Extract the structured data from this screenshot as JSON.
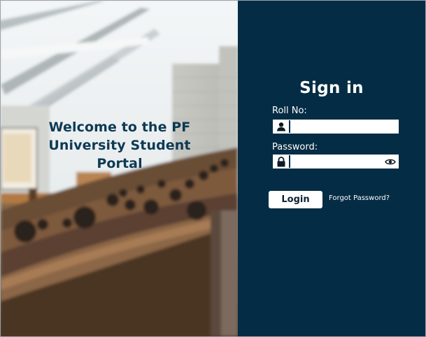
{
  "hero": {
    "title": "Welcome to the PF University Student Portal"
  },
  "signin": {
    "title": "Sign in",
    "roll_label": "Roll No:",
    "roll_value": "",
    "password_label": "Password:",
    "password_value": "",
    "login_label": "Login",
    "forgot_label": "Forgot Password?"
  },
  "icons": {
    "roll": "user-icon",
    "password": "lock-icon",
    "toggle": "eye-icon"
  },
  "colors": {
    "panel_bg": "#042c44",
    "hero_title": "#0d3a55",
    "button_bg": "#ffffff"
  }
}
